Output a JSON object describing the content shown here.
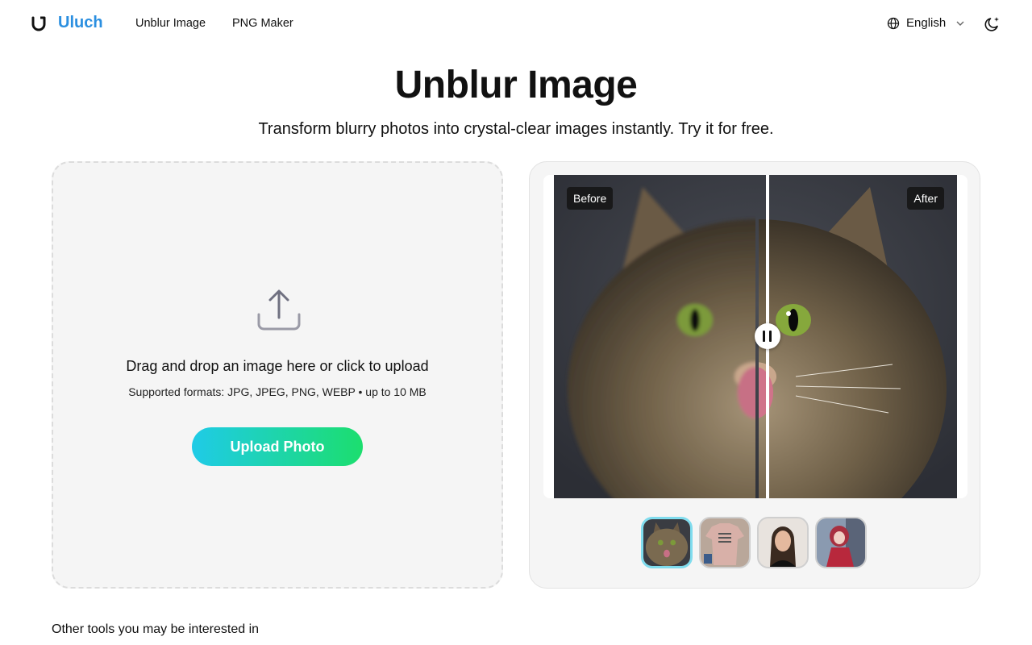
{
  "header": {
    "logo_text": "Uluch",
    "nav": [
      {
        "label": "Unblur Image"
      },
      {
        "label": "PNG Maker"
      }
    ],
    "language": "English",
    "icons": {
      "logo": "uluch-logo-icon",
      "globe": "globe-icon",
      "chevron": "chevron-down-icon",
      "theme": "moon-sparkle-icon"
    },
    "brand_color": "#2b8fe0"
  },
  "hero": {
    "title": "Unblur Image",
    "subtitle": "Transform blurry photos into crystal-clear images instantly. Try it for free."
  },
  "upload": {
    "title": "Drag and drop an image here or click to upload",
    "formats": "Supported formats: JPG, JPEG, PNG, WEBP • up to 10 MB",
    "button_label": "Upload Photo",
    "icon": "upload-icon",
    "button_gradient": [
      "#1fcbe7",
      "#1cde6e"
    ]
  },
  "compare": {
    "before_label": "Before",
    "after_label": "After",
    "handle_icon": "pause-icon",
    "thumbnails": [
      {
        "name": "cat",
        "active": true
      },
      {
        "name": "t-shirt",
        "active": false
      },
      {
        "name": "woman-portrait",
        "active": false
      },
      {
        "name": "anime-girl",
        "active": false
      }
    ]
  },
  "footer": {
    "other_tools": "Other tools you may be interested in"
  }
}
